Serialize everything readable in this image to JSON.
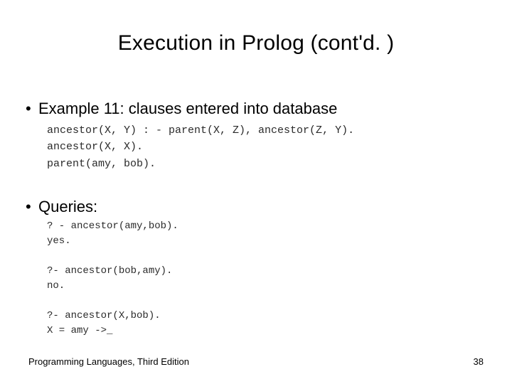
{
  "title": "Execution in Prolog (cont'd. )",
  "bullets": {
    "b1": "Example 11: clauses entered into database",
    "b2": "Queries:"
  },
  "code": {
    "clauses": "ancestor(X, Y) : - parent(X, Z), ancestor(Z, Y).\nancestor(X, X).\nparent(amy, bob).",
    "queries": "? - ancestor(amy,bob).\nyes.\n\n?- ancestor(bob,amy).\nno.\n\n?- ancestor(X,bob).\nX = amy ->_"
  },
  "footer": {
    "left": "Programming Languages, Third Edition",
    "page": "38"
  }
}
